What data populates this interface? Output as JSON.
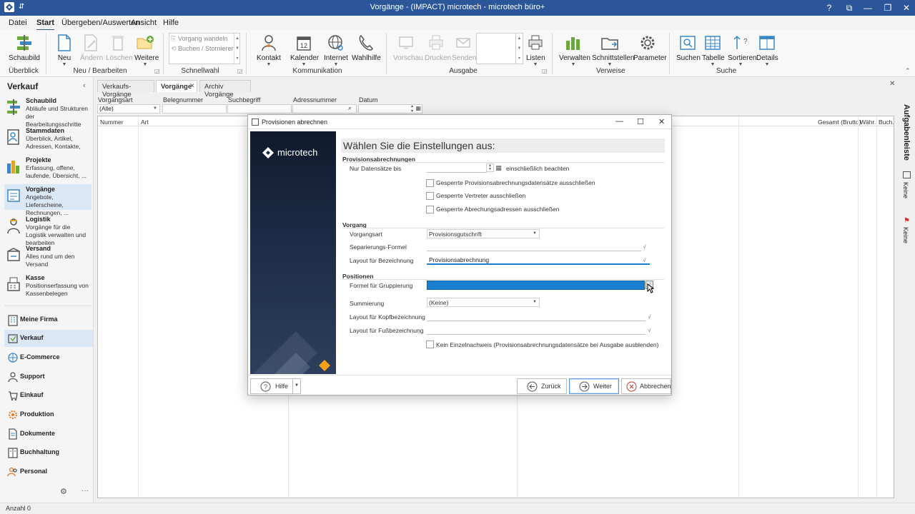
{
  "window": {
    "title": "Vorgänge - (IMPACT) microtech - microtech büro+"
  },
  "menu": {
    "tabs": [
      "Datei",
      "Start",
      "Übergeben/Auswerten",
      "Ansicht",
      "Hilfe"
    ]
  },
  "ribbon": {
    "schaubild": "Schaubild",
    "neu": "Neu",
    "aendern": "Ändern",
    "loeschen": "Löschen",
    "weitere": "Weitere",
    "vorgang_wandeln": "Vorgang wandeln",
    "buchen_stornieren": "Buchen / Stornieren",
    "kontakt": "Kontakt",
    "kalender": "Kalender",
    "kalender_day": "12",
    "internet": "Internet",
    "wahlhilfe": "Wahlhilfe",
    "vorschau": "Vorschau",
    "drucken": "Drucken",
    "senden": "Senden",
    "listen": "Listen",
    "verwalten": "Verwalten",
    "schnittstellen": "Schnittstellen",
    "parameter": "Parameter",
    "suchen": "Suchen",
    "tabelle": "Tabelle",
    "sortieren": "Sortieren",
    "details": "Details",
    "groups": {
      "ueberblick": "Überblick",
      "neu_bearbeiten": "Neu / Bearbeiten",
      "schnellwahl": "Schnellwahl",
      "kommunikation": "Kommunikation",
      "ausgabe": "Ausgabe",
      "verweise": "Verweise",
      "suche": "Suche"
    }
  },
  "leftnav": {
    "header": "Verkauf",
    "items": [
      {
        "title": "Schaubild",
        "desc": "Abläufe und Strukturen der Bearbeitungsschritte"
      },
      {
        "title": "Stammdaten",
        "desc": "Überblick, Artikel, Adressen, Kontakte,"
      },
      {
        "title": "Projekte",
        "desc": "Erfassung, offene, laufende, Übersicht, ..."
      },
      {
        "title": "Vorgänge",
        "desc": "Angebote, Lieferscheine, Rechnungen, ..."
      },
      {
        "title": "Logistik",
        "desc": "Vorgänge für die Logistik verwalten und bearbeiten"
      },
      {
        "title": "Versand",
        "desc": "Alles rund um den Versand"
      },
      {
        "title": "Kasse",
        "desc": "Positionserfassung von Kassenbelegen"
      }
    ],
    "modules": [
      "Meine Firma",
      "Verkauf",
      "E-Commerce",
      "Support",
      "Einkauf",
      "Produktion",
      "Dokumente",
      "Buchhaltung",
      "Personal"
    ]
  },
  "doc_tabs": [
    "Verkaufs-Vorgänge",
    "Vorgänge",
    "Archiv Vorgänge"
  ],
  "filters": {
    "vorgangsart_label": "Vorgangsart",
    "vorgangsart_value": "(Alle)",
    "belegnummer_label": "Belegnummer",
    "suchbegriff_label": "Suchbegriff",
    "adressnummer_label": "Adressnummer",
    "datum_label": "Datum"
  },
  "grid": {
    "columns": [
      "Nummer",
      "Art",
      "Gesamt (Brutto)",
      "Währ.",
      "Buch."
    ]
  },
  "right_panel": {
    "title": "Aufgabenleiste",
    "item1": "Keine",
    "item2": "Keine"
  },
  "status": {
    "count": "Anzahl 0"
  },
  "dialog": {
    "title": "Provisionen abrechnen",
    "brand": "microtech",
    "heading": "Wählen Sie die Einstellungen aus:",
    "section1": "Provisionsabrechnungen",
    "nur_datensaetze_label": "Nur Datensätze bis",
    "einschl_label": "einschließlich beachten",
    "chk1": "Gesperrte Provisionsabrechnungsdatensätze ausschließen",
    "chk2": "Gesperrte Vertreter ausschließen",
    "chk3": "Gesperrte Abrechungsadressen ausschließen",
    "section2": "Vorgang",
    "vorgangsart_label": "Vorgangsart",
    "vorgangsart_value": "Provisionsgutschrift",
    "separierung_label": "Separierungs-Formel",
    "layout_bez_label": "Layout für Bezeichnung",
    "layout_bez_value": "Provisionsabrechnung",
    "section3": "Positionen",
    "formel_grupp_label": "Formel für Gruppierung",
    "summierung_label": "Summierung",
    "summierung_value": "(Keine)",
    "layout_kopf_label": "Layout für Kopfbezeichnung",
    "layout_fuss_label": "Layout für Fußbezeichnung",
    "chk4": "Kein Einzelnachweis (Provisionsabrechnungsdatensätze bei Ausgabe ausblenden)",
    "btn_hilfe": "Hilfe",
    "btn_zurueck": "Zurück",
    "btn_weiter": "Weiter",
    "btn_abbrechen": "Abbrechen"
  },
  "colors": {
    "titlebar": "#2b579a",
    "selection": "#1a7fd1",
    "nav_selected": "#dbe7f4",
    "accent_orange": "#f5a01a"
  }
}
